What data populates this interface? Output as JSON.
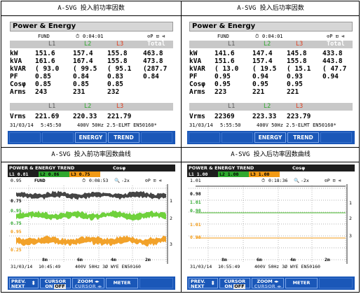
{
  "captions": {
    "top_left": "A-SVG 投入前功率因数",
    "top_right": "A-SVG 投入后功率因数",
    "bottom_left": "A-SVG 投入前功率因数曲线",
    "bottom_right": "A-SVG 投入后功率因数曲线"
  },
  "colors": {
    "L1": "#000000",
    "L2": "#2ea82e",
    "L3": "#e03c1e",
    "L3_trend": "#f29a14",
    "softkey_bg": "#1a57b8"
  },
  "pe_before": {
    "title": "Power & Energy",
    "mode": "FUND",
    "clock_icon": "clock-icon",
    "elapsed": "0:04:01",
    "status_icons": "⊙P ⊡ ⊲",
    "phases": {
      "l1": "L1",
      "l2": "L2",
      "l3": "L3",
      "total": "Total"
    },
    "rows": [
      {
        "label": "kW",
        "l1": "151.6",
        "l2": "157.4",
        "l3": "155.8",
        "total": "463.8"
      },
      {
        "label": "kVA",
        "l1": "161.6",
        "l2": "167.4",
        "l3": "155.8",
        "total": "473.8"
      },
      {
        "label": "kVAR",
        "l1": "( 93.0",
        "l2": "( 99.5",
        "l3": "( 95.1",
        "total": "(287.7"
      },
      {
        "label": "PF",
        "l1": "0.85",
        "l2": "0.84",
        "l3": "0.83",
        "total": "0.84"
      },
      {
        "label": "Cosφ",
        "l1": "0.85",
        "l2": "0.85",
        "l3": "0.85",
        "total": ""
      },
      {
        "label": "Arms",
        "l1": "243",
        "l2": "231",
        "l3": "232",
        "total": ""
      }
    ],
    "vrms": {
      "label": "Vrms",
      "l1": "221.69",
      "l2": "220.33",
      "l3": "221.79"
    },
    "footer": {
      "date": "31/03/14",
      "time": "5:45:50",
      "spec": "400V 50Hz 2.5-ELMT EN50160*"
    },
    "softkeys": [
      "",
      "",
      "ENERGY",
      "TREND",
      ""
    ]
  },
  "pe_after": {
    "title": "Power & Energy",
    "mode": "FUND",
    "clock_icon": "clock-icon",
    "elapsed": "0:04:01",
    "status_icons": "⊙P ⊡ ⊲",
    "phases": {
      "l1": "L1",
      "l2": "L2",
      "l3": "L3",
      "total": "Total"
    },
    "rows": [
      {
        "label": "kW",
        "l1": "141.6",
        "l2": "147.4",
        "l3": "145.8",
        "total": "433.8"
      },
      {
        "label": "kVA",
        "l1": "151.6",
        "l2": "157.4",
        "l3": "155.8",
        "total": "443.8"
      },
      {
        "label": "kVAR",
        "l1": "( 13.0",
        "l2": "( 19.5",
        "l3": "( 15.1",
        "total": "( 47.7"
      },
      {
        "label": "PF",
        "l1": "0.95",
        "l2": "0.94",
        "l3": "0.93",
        "total": "0.94"
      },
      {
        "label": "Cosφ",
        "l1": "0.95",
        "l2": "0.95",
        "l3": "0.95",
        "total": ""
      },
      {
        "label": "Arms",
        "l1": "223",
        "l2": "221",
        "l3": "221",
        "total": ""
      }
    ],
    "vrms": {
      "label": "Vrms",
      "l1": "22369",
      "l2": "223.33",
      "l3": "223.79"
    },
    "footer": {
      "date": "31/03/14",
      "time": "5:55:50",
      "spec": "400V 50Hz 2.5-ELMT EN50160*"
    },
    "softkeys": [
      "",
      "",
      "ENERGY",
      "TREND",
      ""
    ]
  },
  "trend_before": {
    "header": "POWER & ENERGY TREND",
    "header_right": "Cosφ",
    "tabs": [
      {
        "name": "L1",
        "value": "0.81"
      },
      {
        "name": "L2",
        "value": "0.86"
      },
      {
        "name": "L3",
        "value": "0.75"
      }
    ],
    "scale_top": "0.95",
    "mode": "FUND",
    "elapsed": "0:08:53",
    "zoom": "-2x",
    "status_icons": "⊙P ⊡ ⊲",
    "ticks": {
      "l1_top": "0.75",
      "l2_top": "0.95",
      "l2_bot": "0.75",
      "l3_top": "0.95",
      "l3_bot": "0.25"
    },
    "channel_marks": [
      "1",
      "2",
      "3"
    ],
    "time_axis": [
      "8m",
      "6m",
      "4m",
      "2m"
    ],
    "footer": {
      "date": "31/03/14",
      "time": "10:45:49",
      "spec": "400V 50Hz 3Ø WYE EN50160"
    },
    "softkeys": {
      "prev": "PREV.",
      "next": "NEXT",
      "cursor": "CURSOR",
      "on": "ON",
      "off": "OFF",
      "zoom": "ZOOM ◂▸",
      "cursor2": "CURSOR ◂▸",
      "meter": "METER"
    }
  },
  "trend_after": {
    "header": "POWER & ENERGY TREND",
    "header_right": "Cosφ",
    "tabs": [
      {
        "name": "L1",
        "value": "1.00"
      },
      {
        "name": "L2",
        "value": "1.00"
      },
      {
        "name": "L3",
        "value": "1.00"
      }
    ],
    "scale_top": "1.01",
    "mode": "",
    "elapsed": "0:18:36",
    "zoom": "-2x",
    "status_icons": "⊙P ⊡ ⊲",
    "ticks": {
      "l1_top": "0.98",
      "l2_top": "1.01",
      "l2_bot": "0.98",
      "l3_top": "1.01",
      "l3_bot": "0.98"
    },
    "channel_marks": [
      "1",
      "2",
      "3"
    ],
    "time_axis": [
      "8m",
      "6m",
      "4m",
      "2m"
    ],
    "footer": {
      "date": "31/03/14",
      "time": "10:55:49",
      "spec": "400V 50Hz 3Ø WYE EN50160"
    },
    "softkeys": {
      "prev": "PREV.",
      "next": "NEXT",
      "cursor": "CURSOR",
      "on": "ON",
      "off": "OFF",
      "zoom": "ZOOM ◂▸",
      "cursor2": "CURSOR ◂▸",
      "meter": "METER"
    }
  }
}
